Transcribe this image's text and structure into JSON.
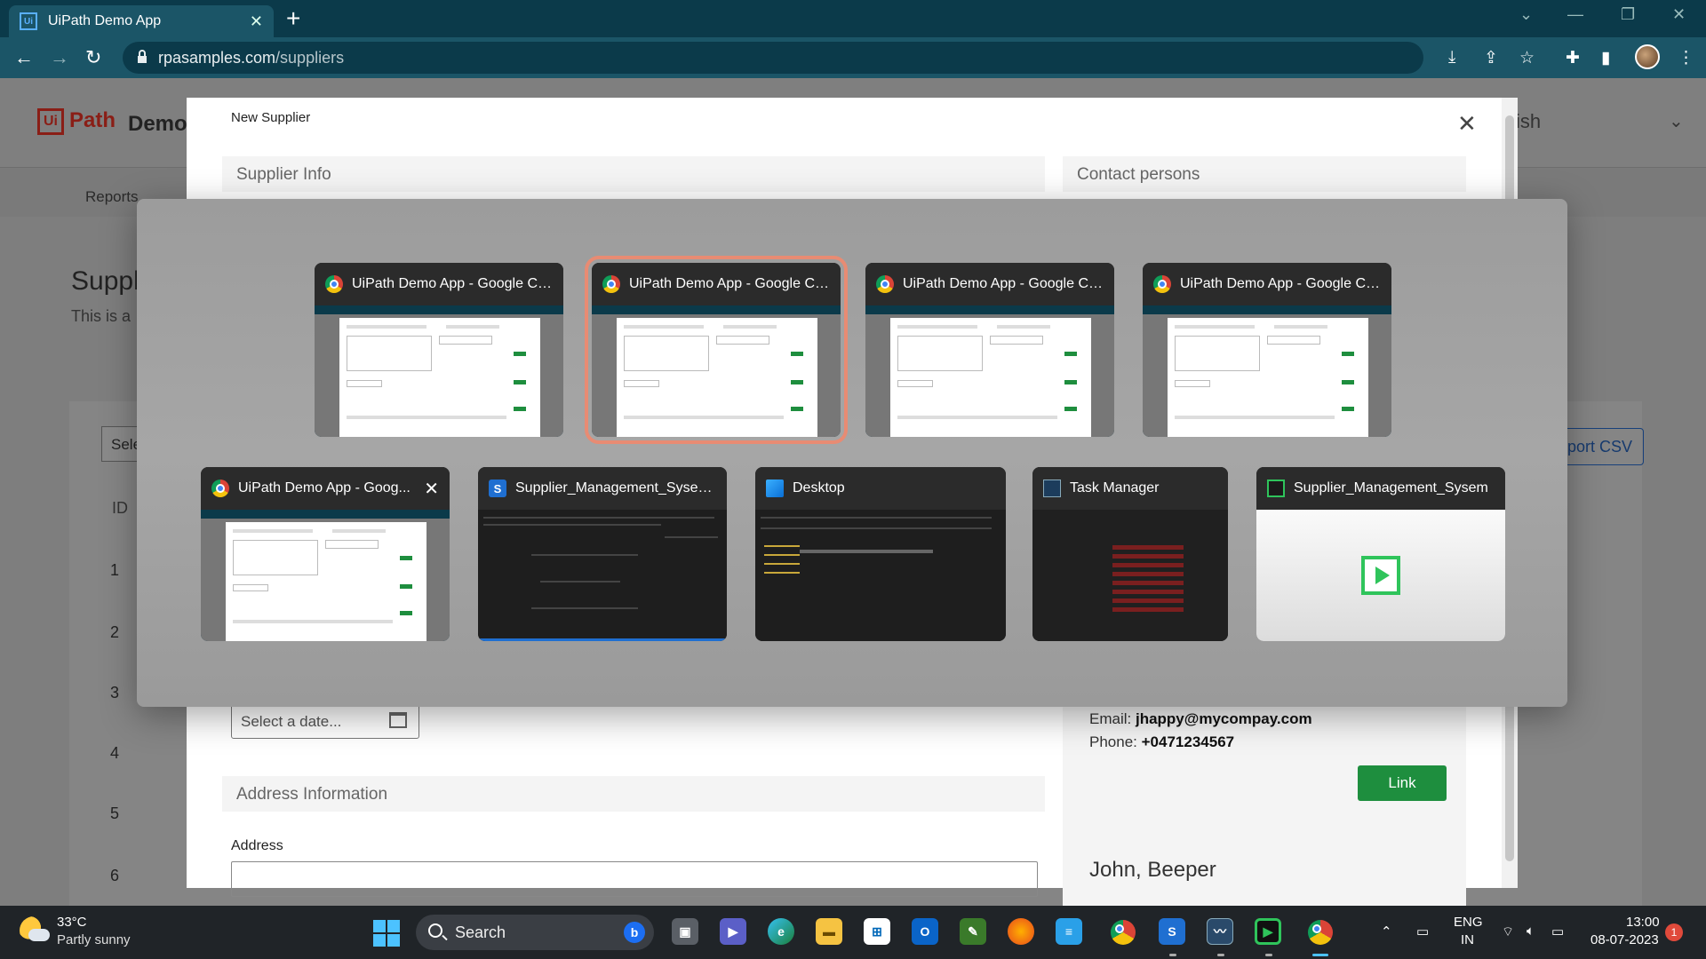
{
  "browser": {
    "tab_title": "UiPath Demo App",
    "url_domain": "rpasamples.com",
    "url_path": "/suppliers"
  },
  "page": {
    "logo_ui": "Ui",
    "logo_path": "Path",
    "logo_demo": "Demo",
    "header_partial_right": "ish",
    "nav_reports": "Reports",
    "title_partial": "Suppl",
    "description_partial": "This is a",
    "select_partial": "Sele",
    "column_id": "ID",
    "row_ids": [
      "1",
      "2",
      "3",
      "4",
      "5",
      "6"
    ],
    "export_partial": "port CSV"
  },
  "modal": {
    "title": "New Supplier",
    "supplier_info": "Supplier Info",
    "contact_persons": "Contact persons",
    "date_placeholder": "Select a date...",
    "address_information": "Address Information",
    "address_label": "Address",
    "contact_email_label": "Email:",
    "contact_email": "jhappy@mycompay.com",
    "contact_phone_label": "Phone:",
    "contact_phone": "+0471234567",
    "link_button": "Link",
    "next_contact_name": "John, Beeper"
  },
  "switcher": {
    "selected_index": 1,
    "windows": [
      {
        "title": "UiPath Demo App - Google Ch...",
        "icon": "chrome-icon"
      },
      {
        "title": "UiPath Demo App - Google Ch...",
        "icon": "chrome-icon"
      },
      {
        "title": "UiPath Demo App - Google Ch...",
        "icon": "chrome-icon"
      },
      {
        "title": "UiPath Demo App - Google Ch...",
        "icon": "chrome-icon"
      },
      {
        "title": "UiPath Demo App - Goog...",
        "icon": "chrome-icon"
      },
      {
        "title": "Supplier_Management_Sysem...",
        "icon": "uipath-studio-icon"
      },
      {
        "title": "Desktop",
        "icon": "desktop-icon"
      },
      {
        "title": "Task Manager",
        "icon": "task-manager-icon"
      },
      {
        "title": "Supplier_Management_Sysem",
        "icon": "uipath-robot-icon"
      }
    ]
  },
  "taskbar": {
    "temperature": "33°C",
    "condition": "Partly sunny",
    "search_label": "Search",
    "language_line1": "ENG",
    "language_line2": "IN",
    "time": "13:00",
    "date": "08-07-2023",
    "notification_count": "1"
  },
  "colors": {
    "chrome_tabstrip": "#0b3a4a",
    "chrome_toolbar": "#1b5567",
    "uipath_red": "#8a1e16",
    "link_green": "#1e8e3e",
    "selection_outline": "#e88b73",
    "taskbar": "#202428"
  }
}
